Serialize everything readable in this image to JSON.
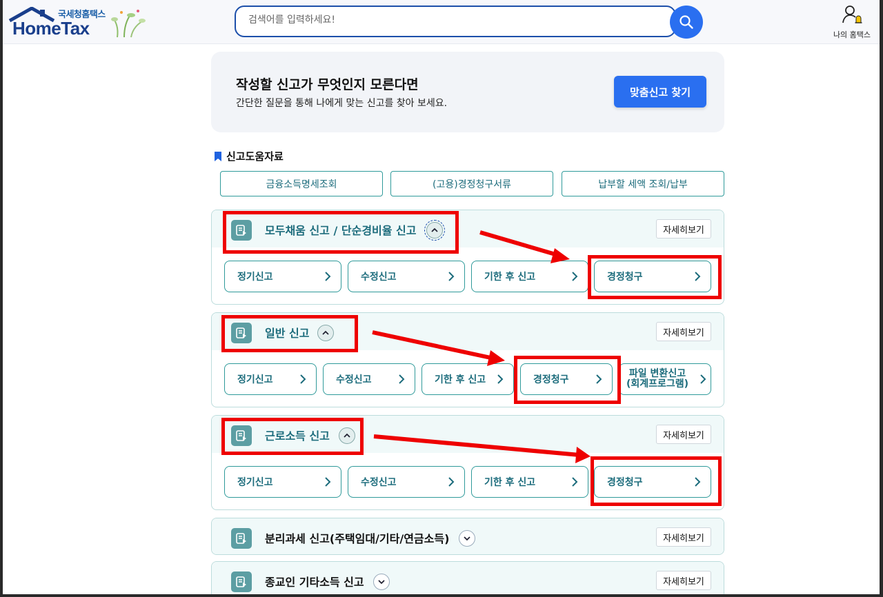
{
  "header": {
    "logo_sub": "국세청홈택스",
    "logo_main": "HomeTax",
    "search_placeholder": "검색어를 입력하세요!",
    "my_hometax": "나의 홈택스"
  },
  "banner": {
    "title": "작성할 신고가 무엇인지 모른다면",
    "desc": "간단한 질문을 통해 나에게 맞는 신고를 찾아 보세요.",
    "button": "맞춤신고 찾기"
  },
  "help": {
    "title": "신고도움자료",
    "buttons": [
      "금융소득명세조회",
      "(고용)경정청구서류",
      "납부할 세액 조회/납부"
    ]
  },
  "sections": [
    {
      "title": "모두채움 신고 / 단순경비율 신고",
      "detail": "자세히보기",
      "options": [
        "정기신고",
        "수정신고",
        "기한 후 신고",
        "경정청구"
      ]
    },
    {
      "title": "일반 신고",
      "detail": "자세히보기",
      "options": [
        "정기신고",
        "수정신고",
        "기한 후 신고",
        "경정청구",
        "파일 변환신고",
        "(회계프로그램)"
      ]
    },
    {
      "title": "근로소득 신고",
      "detail": "자세히보기",
      "options": [
        "정기신고",
        "수정신고",
        "기한 후 신고",
        "경정청구"
      ]
    },
    {
      "title": "분리과세 신고(주택임대/기타/연금소득)",
      "detail": "자세히보기"
    },
    {
      "title": "종교인 기타소득 신고",
      "detail": "자세히보기"
    }
  ],
  "colors": {
    "primary_blue": "#2a6ff0",
    "teal_text": "#1c6c7c",
    "teal_border": "#2f9a9a",
    "annotation_red": "#ee0000"
  }
}
